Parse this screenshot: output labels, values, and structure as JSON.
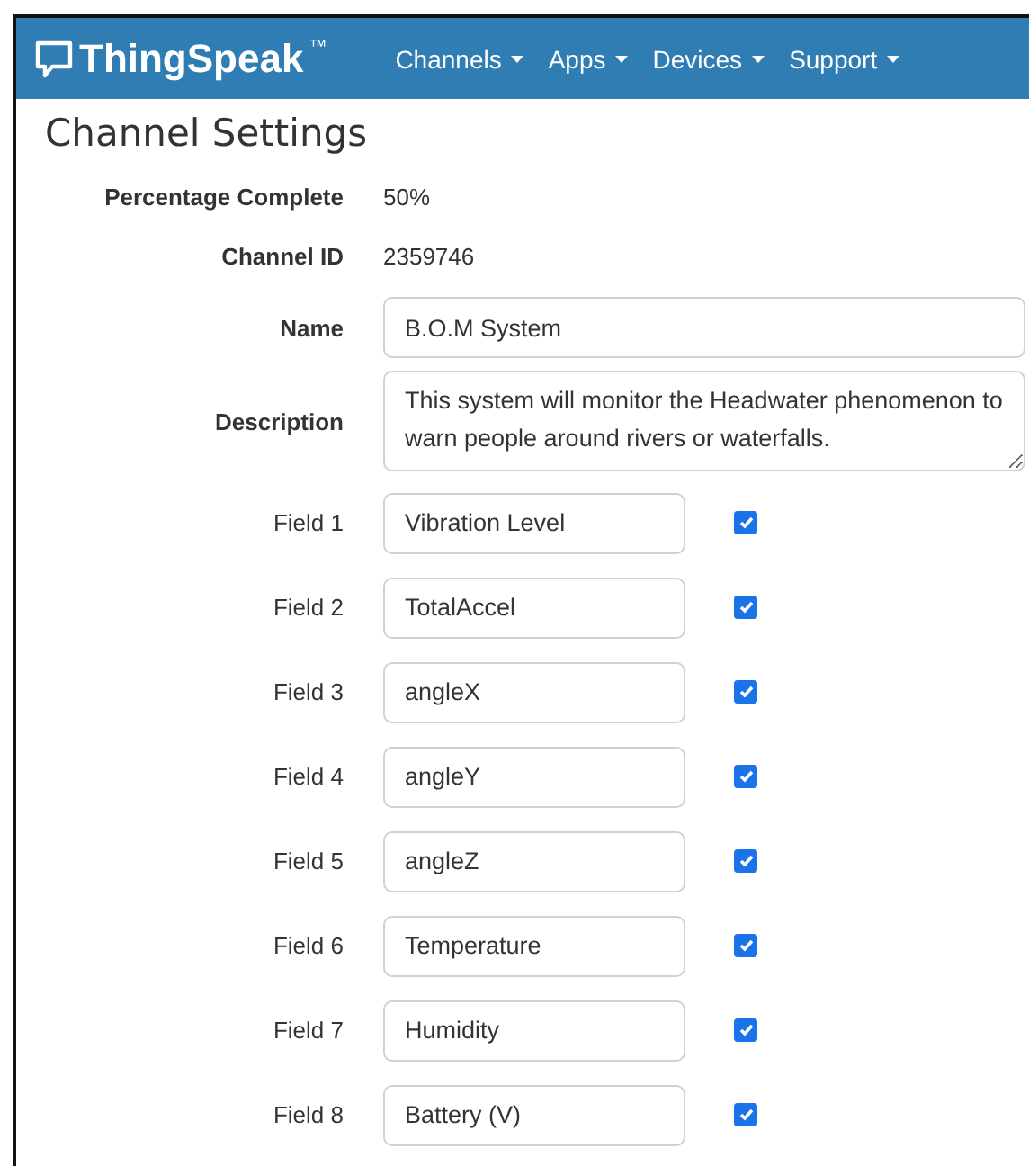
{
  "navbar": {
    "brand": "ThingSpeak",
    "trademark": "™",
    "menus": [
      {
        "label": "Channels"
      },
      {
        "label": "Apps"
      },
      {
        "label": "Devices"
      },
      {
        "label": "Support"
      }
    ]
  },
  "page_title": "Channel Settings",
  "info": [
    {
      "label": "Percentage Complete",
      "value": "50%"
    },
    {
      "label": "Channel ID",
      "value": "2359746"
    }
  ],
  "name": {
    "label": "Name",
    "value": "B.O.M System"
  },
  "description": {
    "label": "Description",
    "value": "This system will monitor the Headwater phenomenon to warn people around rivers or waterfalls."
  },
  "fields": [
    {
      "label": "Field 1",
      "value": "Vibration Level",
      "checked": true
    },
    {
      "label": "Field 2",
      "value": "TotalAccel",
      "checked": true
    },
    {
      "label": "Field 3",
      "value": "angleX",
      "checked": true
    },
    {
      "label": "Field 4",
      "value": "angleY",
      "checked": true
    },
    {
      "label": "Field 5",
      "value": "angleZ",
      "checked": true
    },
    {
      "label": "Field 6",
      "value": "Temperature",
      "checked": true
    },
    {
      "label": "Field 7",
      "value": "Humidity",
      "checked": true
    },
    {
      "label": "Field 8",
      "value": "Battery (V)",
      "checked": true
    }
  ]
}
